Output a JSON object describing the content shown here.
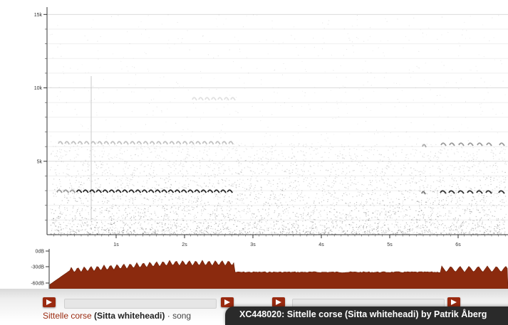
{
  "spectrogram": {
    "freq_labels": [
      "15k",
      "10k",
      "5k"
    ],
    "time_labels": [
      "1s",
      "2s",
      "3s",
      "4s",
      "5s",
      "6s"
    ]
  },
  "waveform": {
    "db_labels": [
      "0dB",
      "-30dB",
      "-60dB"
    ],
    "fill_color": "#8b2a0e"
  },
  "player": {
    "play_icon": "play-icon"
  },
  "recording": {
    "common_name": "Sittelle corse",
    "scientific_name": "(Sitta whiteheadi)",
    "separator": "·",
    "sound_type": "song"
  },
  "caption": {
    "text": "XC448020: Sittelle corse (Sitta whiteheadi) by Patrik Åberg"
  }
}
